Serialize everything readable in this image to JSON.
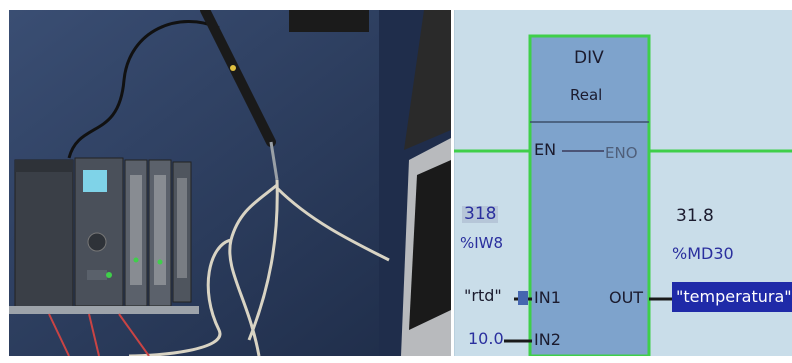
{
  "photo": {
    "hardware": "plc-cpu-with-io-modules-and-temperature-probe",
    "colors": {
      "table": "#283a5c",
      "plc_body": "#3e4450",
      "cable": "#d9d4c4",
      "laptop": "#b8babd"
    }
  },
  "ladder": {
    "block": {
      "name": "DIV",
      "type": "Real"
    },
    "pins": {
      "en": "EN",
      "eno": "ENO",
      "in1": "IN1",
      "in2": "IN2",
      "out": "OUT"
    },
    "in1": {
      "value": "318",
      "address": "%IW8",
      "tag": "\"rtd\""
    },
    "in2": {
      "value": "10.0"
    },
    "out": {
      "value": "31.8",
      "address": "%MD30",
      "tag": "\"temperatura\""
    },
    "colors": {
      "background": "#c9dde9",
      "block_fill": "#7ea3cc",
      "block_border": "#3fcf4a",
      "power_rail": "#3fcf4a",
      "tag_highlight": "#1f2aa8",
      "value_text": "#2a2f9e"
    }
  }
}
